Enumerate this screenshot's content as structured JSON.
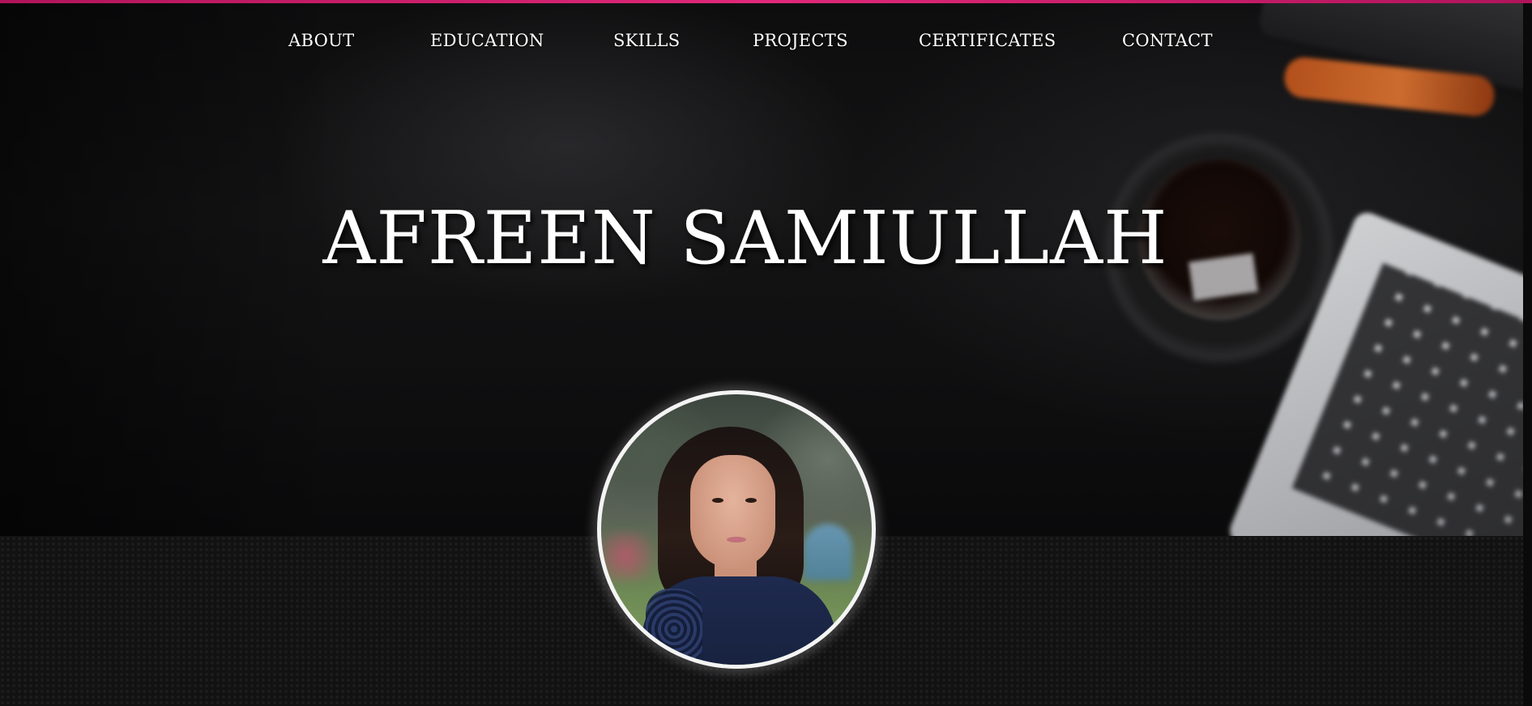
{
  "theme": {
    "accent": "#e0287a",
    "background": "#0b0b0c",
    "text": "#ffffff"
  },
  "nav": {
    "items": [
      {
        "label": "ABOUT",
        "name": "nav-about"
      },
      {
        "label": "EDUCATION",
        "name": "nav-education"
      },
      {
        "label": "SKILLS",
        "name": "nav-skills"
      },
      {
        "label": "PROJECTS",
        "name": "nav-projects"
      },
      {
        "label": "CERTIFICATES",
        "name": "nav-certificates"
      },
      {
        "label": "CONTACT",
        "name": "nav-contact"
      }
    ]
  },
  "hero": {
    "title": "AFREEN SAMIULLAH"
  },
  "profile": {
    "avatar_alt": "profile photo"
  }
}
